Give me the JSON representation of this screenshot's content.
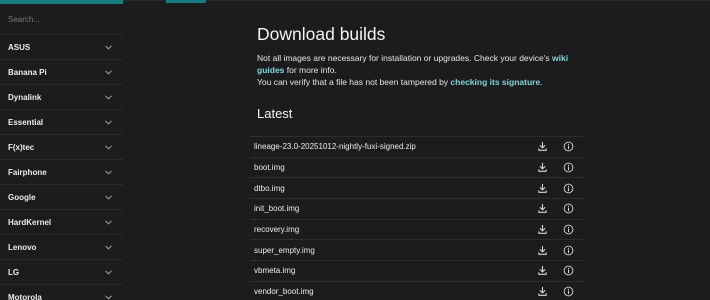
{
  "colors": {
    "accent": "#167c80",
    "link": "#7fd6d9",
    "background": "#1c1c1e"
  },
  "sidebar": {
    "search_placeholder": "Search...",
    "vendors": [
      {
        "label": "ASUS"
      },
      {
        "label": "Banana Pi"
      },
      {
        "label": "Dynalink"
      },
      {
        "label": "Essential"
      },
      {
        "label": "F(x)tec"
      },
      {
        "label": "Fairphone"
      },
      {
        "label": "Google"
      },
      {
        "label": "HardKernel"
      },
      {
        "label": "Lenovo"
      },
      {
        "label": "LG"
      },
      {
        "label": "Motorola"
      }
    ]
  },
  "main": {
    "title": "Download builds",
    "intro": {
      "line1_prefix": "Not all images are necessary for installation or upgrades. Check your device's ",
      "wiki_link": "wiki guides",
      "line1_suffix": " for more info.",
      "line2_prefix": "You can verify that a file has not been tampered by ",
      "signature_link": "checking its signature",
      "line2_suffix": "."
    },
    "latest_heading": "Latest",
    "files": [
      {
        "name": "lineage-23.0-20251012-nightly-fuxi-signed.zip",
        "download_icon": "download-icon",
        "info_icon": "info-icon"
      },
      {
        "name": "boot.img",
        "download_icon": "download-icon",
        "info_icon": "info-icon"
      },
      {
        "name": "dtbo.img",
        "download_icon": "download-icon",
        "info_icon": "info-icon"
      },
      {
        "name": "init_boot.img",
        "download_icon": "download-icon",
        "info_icon": "info-icon"
      },
      {
        "name": "recovery.img",
        "download_icon": "download-icon",
        "info_icon": "info-icon"
      },
      {
        "name": "super_empty.img",
        "download_icon": "download-icon",
        "info_icon": "info-icon"
      },
      {
        "name": "vbmeta.img",
        "download_icon": "download-icon",
        "info_icon": "info-icon"
      },
      {
        "name": "vendor_boot.img",
        "download_icon": "download-icon",
        "info_icon": "info-icon"
      }
    ]
  }
}
